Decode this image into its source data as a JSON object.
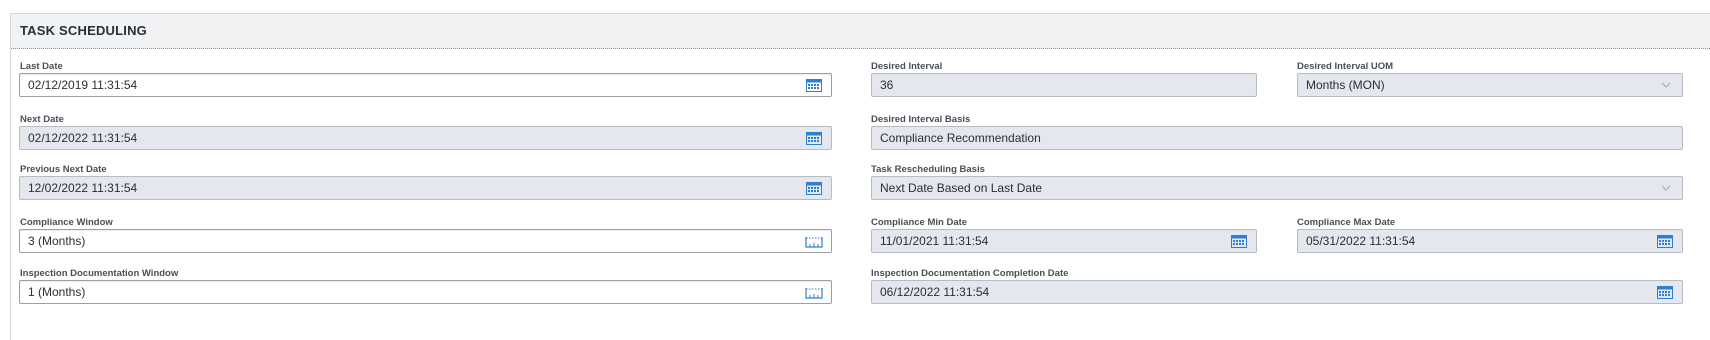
{
  "section": {
    "title": "TASK SCHEDULING"
  },
  "fields": {
    "last_date": {
      "label": "Last Date",
      "value": "02/12/2019 11:31:54",
      "icon": "calendar-icon"
    },
    "desired_interval": {
      "label": "Desired Interval",
      "value": "36"
    },
    "desired_interval_uom": {
      "label": "Desired Interval UOM",
      "value": "Months (MON)",
      "icon": "chevron-down-icon"
    },
    "next_date": {
      "label": "Next Date",
      "value": "02/12/2022 11:31:54",
      "icon": "calendar-icon"
    },
    "desired_interval_basis": {
      "label": "Desired Interval Basis",
      "value": "Compliance Recommendation"
    },
    "previous_next_date": {
      "label": "Previous Next Date",
      "value": "12/02/2022 11:31:54",
      "icon": "calendar-icon"
    },
    "task_rescheduling_basis": {
      "label": "Task Rescheduling Basis",
      "value": "Next Date Based on Last Date",
      "icon": "chevron-down-icon"
    },
    "compliance_window": {
      "label": "Compliance Window",
      "value": "3 (Months)",
      "icon": "ruler-icon"
    },
    "compliance_min_date": {
      "label": "Compliance Min Date",
      "value": "11/01/2021 11:31:54",
      "icon": "calendar-icon"
    },
    "compliance_max_date": {
      "label": "Compliance Max Date",
      "value": "05/31/2022 11:31:54",
      "icon": "calendar-icon"
    },
    "inspection_documentation_window": {
      "label": "Inspection Documentation Window",
      "value": "1 (Months)",
      "icon": "ruler-icon"
    },
    "inspection_documentation_completion_date": {
      "label": "Inspection Documentation Completion Date",
      "value": "06/12/2022 11:31:54",
      "icon": "calendar-icon"
    }
  },
  "colors": {
    "icon_blue": "#2f7fd1",
    "readonly_bg": "#e4e8ee",
    "header_bg": "#f1f2f4"
  }
}
